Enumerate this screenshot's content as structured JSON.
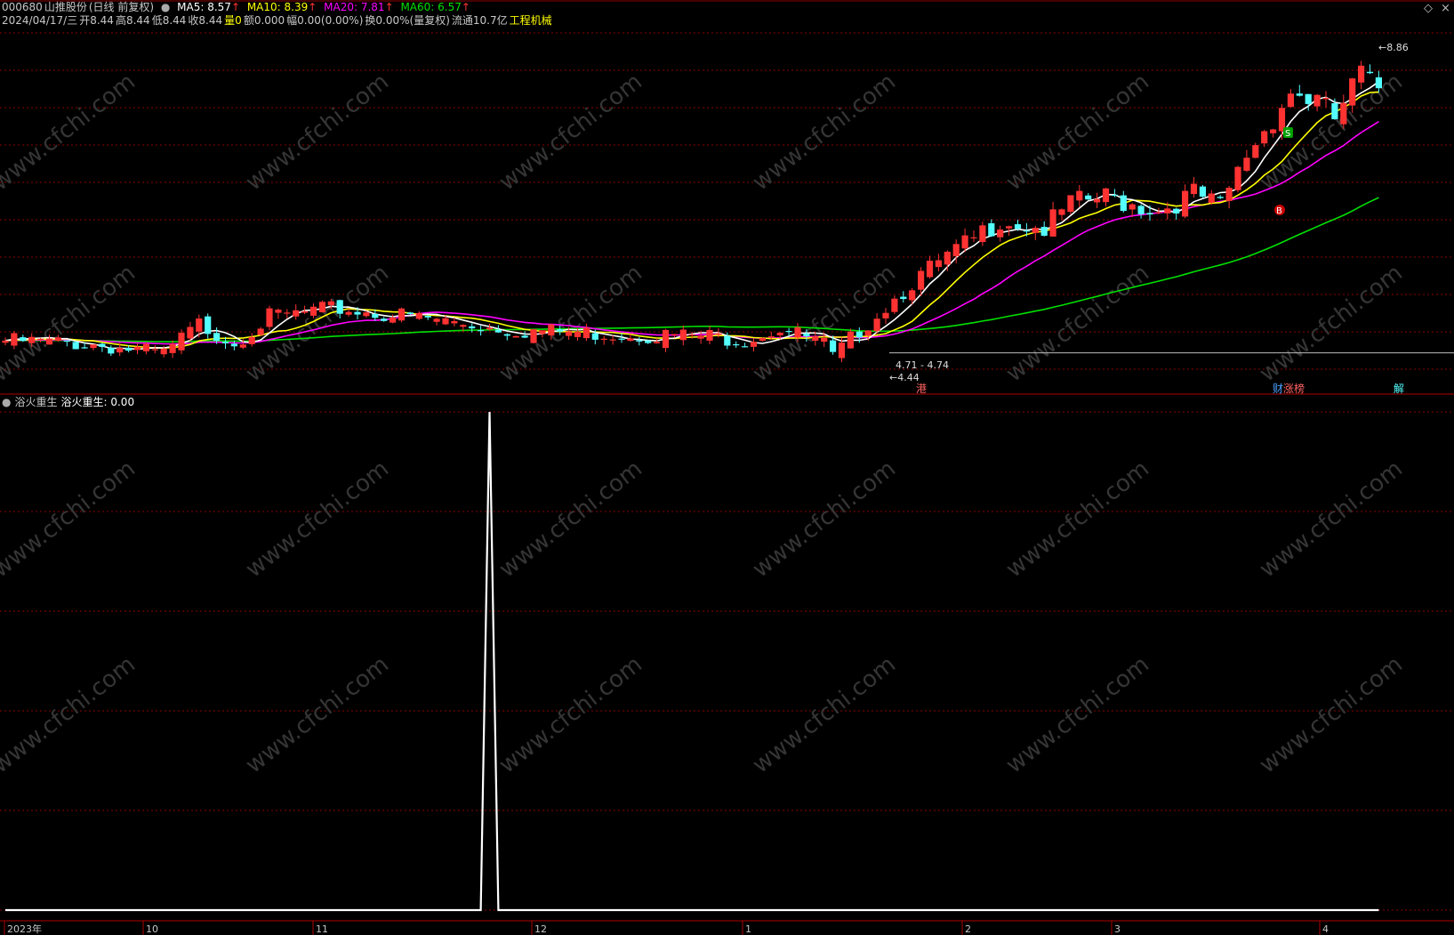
{
  "header": {
    "code": "000680",
    "name": "山推股份",
    "mode": "(日线 前复权)",
    "ma5_label": "MA5: 8.57",
    "ma10_label": "MA10: 8.39",
    "ma20_label": "MA20: 7.81",
    "ma60_label": "MA60: 6.57",
    "arrow": "↑"
  },
  "quote": {
    "date": "2024/04/17/三",
    "open": "开8.44",
    "high": "高8.44",
    "low": "低8.44",
    "close": "收8.44",
    "vol_label": "量",
    "vol_value": "0",
    "amount": "额0.000",
    "change": "幅0.00(0.00%)",
    "turnover": "换0.00%(量复权)",
    "float_cap": "流通10.7亿",
    "industry": "工程机械"
  },
  "indicator": {
    "name": "浴火重生",
    "value_label": "浴火重生: 0.00"
  },
  "annotations": {
    "range_label": "4.71 - 4.74",
    "low_label": "4.44",
    "high_label": "8.86",
    "b_marker": "B",
    "s_marker": "S",
    "tag_gang": "港",
    "tag_cai": "财",
    "tag_zhang": "涨榜",
    "tag_jie": "解"
  },
  "watermark": "www.cfchi.com",
  "colors": {
    "up": "#ff3232",
    "down": "#54ffff",
    "ma5": "#ffffff",
    "ma10": "#ffff00",
    "ma20": "#ff00ff",
    "ma60": "#00e000",
    "grid": "#8a0000",
    "indicator": "#ffffff"
  },
  "chart_data": [
    {
      "type": "candlestick",
      "title": "000680 山推股份 (日线 前复权)",
      "x_labels": [
        "2023年",
        "10",
        "11",
        "12",
        "1",
        "2",
        "3",
        "4"
      ],
      "ylim": [
        4.2,
        9.3
      ],
      "price_low": 4.44,
      "price_high": 8.86,
      "reference_line": 4.74,
      "close_key_points": [
        {
          "i": 0,
          "close": 4.97
        },
        {
          "i": 10,
          "close": 4.92
        },
        {
          "i": 18,
          "close": 4.78
        },
        {
          "i": 22,
          "close": 5.2
        },
        {
          "i": 26,
          "close": 4.95
        },
        {
          "i": 30,
          "close": 5.3
        },
        {
          "i": 38,
          "close": 5.42
        },
        {
          "i": 48,
          "close": 5.28
        },
        {
          "i": 58,
          "close": 5.12
        },
        {
          "i": 66,
          "close": 5.08
        },
        {
          "i": 80,
          "close": 5.03
        },
        {
          "i": 84,
          "close": 4.99
        },
        {
          "i": 88,
          "close": 5.15
        },
        {
          "i": 93,
          "close": 4.92
        },
        {
          "i": 94,
          "close": 4.72
        },
        {
          "i": 97,
          "close": 5.12
        },
        {
          "i": 103,
          "close": 5.8
        },
        {
          "i": 110,
          "close": 6.4
        },
        {
          "i": 113,
          "close": 6.7
        },
        {
          "i": 118,
          "close": 6.55
        },
        {
          "i": 121,
          "close": 6.9
        },
        {
          "i": 125,
          "close": 7.0
        },
        {
          "i": 131,
          "close": 6.82
        },
        {
          "i": 135,
          "close": 7.05
        },
        {
          "i": 138,
          "close": 6.85
        },
        {
          "i": 141,
          "close": 7.6
        },
        {
          "i": 146,
          "close": 8.5
        },
        {
          "i": 149,
          "close": 8.35
        },
        {
          "i": 151,
          "close": 8.1
        },
        {
          "i": 154,
          "close": 8.75
        },
        {
          "i": 155,
          "close": 8.57
        },
        {
          "i": 156,
          "close": 8.44
        }
      ],
      "series": [
        {
          "name": "MA5",
          "last": 8.57
        },
        {
          "name": "MA10",
          "last": 8.39
        },
        {
          "name": "MA20",
          "last": 7.81
        },
        {
          "name": "MA60",
          "last": 6.57
        }
      ]
    },
    {
      "type": "line",
      "title": "浴火重生",
      "ylim": [
        0,
        1
      ],
      "baseline": 0,
      "spike_index": 55,
      "spike_value": 1,
      "last_value": 0.0
    }
  ]
}
